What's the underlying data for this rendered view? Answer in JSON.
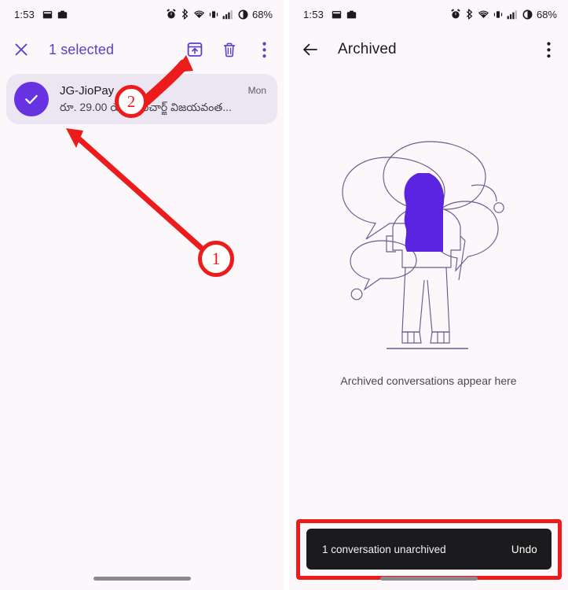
{
  "meta": {
    "accent_purple": "#5b3ecb",
    "avatar_purple": "#6733e0",
    "annotation_red": "#ec1c1c",
    "snackbar_bg": "#1b1b1d",
    "panel_bg": "#fbf7fb"
  },
  "status_bar": {
    "time": "1:53",
    "battery_text": "68%",
    "left_icons": [
      "calendar-icon",
      "camera-icon"
    ],
    "right_icons": [
      "alarm-icon",
      "bluetooth-icon",
      "wifi-icon",
      "vibrate-icon",
      "signal-icon",
      "battery-icon"
    ]
  },
  "left_panel": {
    "appbar": {
      "close_label": "close-icon",
      "title": "1 selected",
      "actions": [
        {
          "name": "archive",
          "icon": "archive-icon"
        },
        {
          "name": "delete",
          "icon": "trash-icon"
        },
        {
          "name": "more",
          "icon": "overflow-menu-icon"
        }
      ]
    },
    "conversation": {
      "selected": true,
      "avatar_icon": "check-icon",
      "sender": "JG-JioPay",
      "snippet": "రూ. 29.00 యొక్క రిచార్జ్ విజయవంత...",
      "time": "Mon"
    }
  },
  "right_panel": {
    "appbar": {
      "back_label": "back-arrow-icon",
      "title": "Archived",
      "actions": [
        {
          "name": "more",
          "icon": "overflow-menu-icon"
        }
      ]
    },
    "empty_state": {
      "illustration": "person-with-speech-bubbles-illustration",
      "caption": "Archived conversations appear here"
    },
    "snackbar": {
      "message": "1 conversation unarchived",
      "action_label": "Undo",
      "highlighted": true
    }
  },
  "annotations": {
    "markers": [
      {
        "label": "1",
        "points_to": "selected-conversation-row"
      },
      {
        "label": "2",
        "points_to": "archive-button"
      }
    ]
  }
}
